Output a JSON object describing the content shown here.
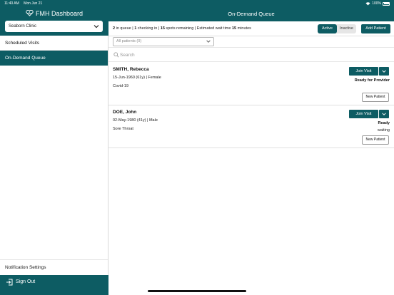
{
  "status_bar": {
    "time": "11:40 AM",
    "date": "Mon Jun 21",
    "battery": "100%"
  },
  "sidebar": {
    "app_title": "FMH Dashboard",
    "clinic": "Seaborn Clinic",
    "items": [
      {
        "label": "Scheduled Visits",
        "active": false
      },
      {
        "label": "On-Demand Queue",
        "active": true
      }
    ],
    "notification_settings": "Notification Settings",
    "sign_out": "Sign Out"
  },
  "main": {
    "title": "On-Demand Queue",
    "queue_info": {
      "in_queue": "2",
      "in_queue_text": " in queue | ",
      "checking_in": "1",
      "checking_in_text": " checking in | ",
      "spots": "15",
      "spots_text": " spots remaining | Estimated wait time ",
      "wait": "15",
      "wait_text": " minutes"
    },
    "toggle": {
      "active_label": "Active",
      "inactive_label": "Inactive",
      "selected": "Active"
    },
    "add_patient_label": "Add Patient",
    "filter_label": "All patients (0)",
    "search_placeholder": "Search",
    "patients": [
      {
        "name": "SMITH, Rebecca",
        "dob": "15-Jun-1960 (61y) | Female",
        "reason": "Covid-19",
        "join_label": "Join Visit",
        "status": "Ready for Provider",
        "substatus": "",
        "badge": "New Patient"
      },
      {
        "name": "DOE, John",
        "dob": "02-May-1980 (41y) | Male",
        "reason": "Sore Throat",
        "join_label": "Join Visit",
        "status": "Ready",
        "substatus": "waiting",
        "badge": "New Patient"
      }
    ]
  },
  "colors": {
    "brand": "#0d5c63"
  }
}
